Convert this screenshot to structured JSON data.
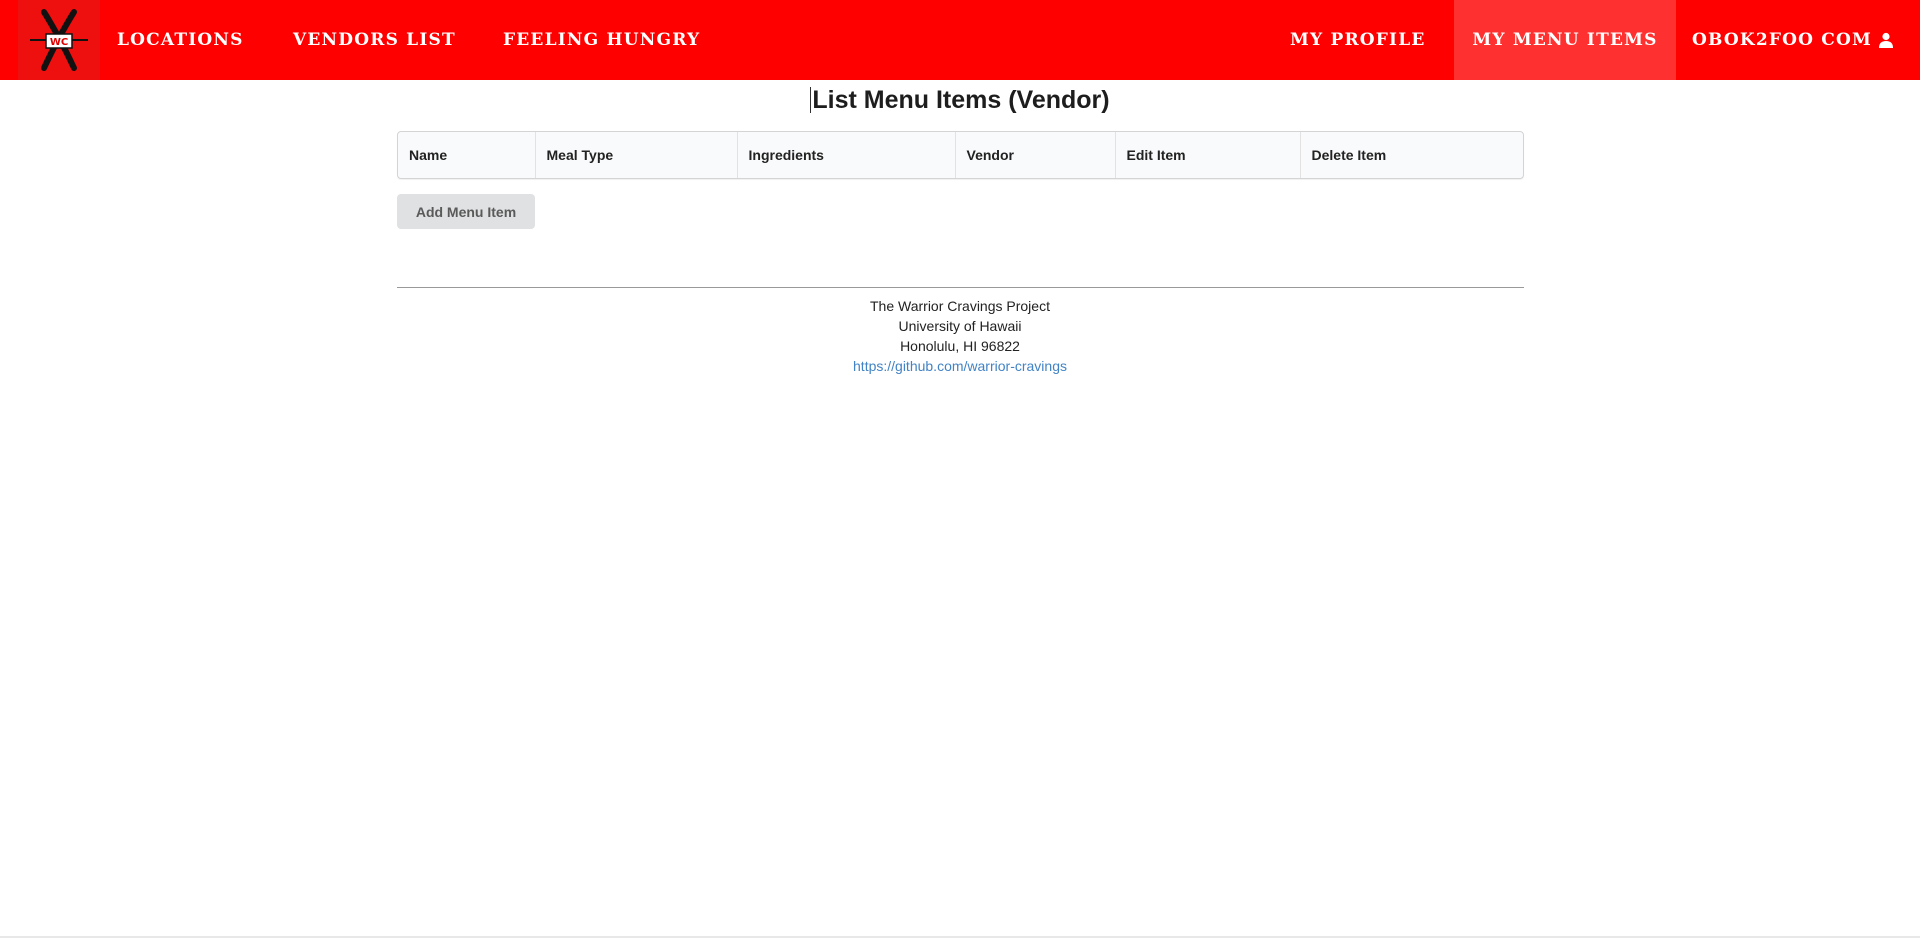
{
  "navbar": {
    "logo_text": "WC",
    "items": [
      {
        "label": "Locations"
      },
      {
        "label": "Vendors List"
      },
      {
        "label": "Feeling Hungry"
      }
    ],
    "right_items": [
      {
        "label": "My Profile"
      },
      {
        "label": "My Menu Items"
      },
      {
        "label": "obok2foo com"
      }
    ],
    "accent_color": "#ff0000",
    "user_icon": "user-icon"
  },
  "main": {
    "title": "List Menu Items (Vendor)",
    "table_headers": [
      "Name",
      "Meal Type",
      "Ingredients",
      "Vendor",
      "Edit Item",
      "Delete Item"
    ],
    "add_button_label": "Add Menu Item"
  },
  "footer": {
    "line1": "The Warrior Cravings Project",
    "line2": "University of Hawaii",
    "line3": "Honolulu, HI 96822",
    "link": "https://github.com/warrior-cravings"
  }
}
